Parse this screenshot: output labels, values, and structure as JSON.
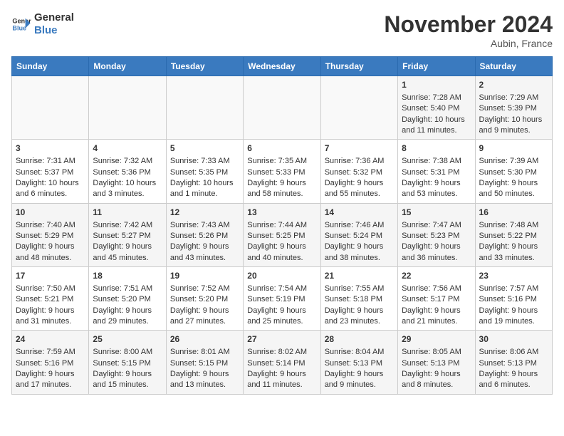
{
  "header": {
    "logo_line1": "General",
    "logo_line2": "Blue",
    "title": "November 2024",
    "location": "Aubin, France"
  },
  "days_of_week": [
    "Sunday",
    "Monday",
    "Tuesday",
    "Wednesday",
    "Thursday",
    "Friday",
    "Saturday"
  ],
  "weeks": [
    [
      {
        "day": "",
        "content": ""
      },
      {
        "day": "",
        "content": ""
      },
      {
        "day": "",
        "content": ""
      },
      {
        "day": "",
        "content": ""
      },
      {
        "day": "",
        "content": ""
      },
      {
        "day": "1",
        "content": "Sunrise: 7:28 AM\nSunset: 5:40 PM\nDaylight: 10 hours and 11 minutes."
      },
      {
        "day": "2",
        "content": "Sunrise: 7:29 AM\nSunset: 5:39 PM\nDaylight: 10 hours and 9 minutes."
      }
    ],
    [
      {
        "day": "3",
        "content": "Sunrise: 7:31 AM\nSunset: 5:37 PM\nDaylight: 10 hours and 6 minutes."
      },
      {
        "day": "4",
        "content": "Sunrise: 7:32 AM\nSunset: 5:36 PM\nDaylight: 10 hours and 3 minutes."
      },
      {
        "day": "5",
        "content": "Sunrise: 7:33 AM\nSunset: 5:35 PM\nDaylight: 10 hours and 1 minute."
      },
      {
        "day": "6",
        "content": "Sunrise: 7:35 AM\nSunset: 5:33 PM\nDaylight: 9 hours and 58 minutes."
      },
      {
        "day": "7",
        "content": "Sunrise: 7:36 AM\nSunset: 5:32 PM\nDaylight: 9 hours and 55 minutes."
      },
      {
        "day": "8",
        "content": "Sunrise: 7:38 AM\nSunset: 5:31 PM\nDaylight: 9 hours and 53 minutes."
      },
      {
        "day": "9",
        "content": "Sunrise: 7:39 AM\nSunset: 5:30 PM\nDaylight: 9 hours and 50 minutes."
      }
    ],
    [
      {
        "day": "10",
        "content": "Sunrise: 7:40 AM\nSunset: 5:29 PM\nDaylight: 9 hours and 48 minutes."
      },
      {
        "day": "11",
        "content": "Sunrise: 7:42 AM\nSunset: 5:27 PM\nDaylight: 9 hours and 45 minutes."
      },
      {
        "day": "12",
        "content": "Sunrise: 7:43 AM\nSunset: 5:26 PM\nDaylight: 9 hours and 43 minutes."
      },
      {
        "day": "13",
        "content": "Sunrise: 7:44 AM\nSunset: 5:25 PM\nDaylight: 9 hours and 40 minutes."
      },
      {
        "day": "14",
        "content": "Sunrise: 7:46 AM\nSunset: 5:24 PM\nDaylight: 9 hours and 38 minutes."
      },
      {
        "day": "15",
        "content": "Sunrise: 7:47 AM\nSunset: 5:23 PM\nDaylight: 9 hours and 36 minutes."
      },
      {
        "day": "16",
        "content": "Sunrise: 7:48 AM\nSunset: 5:22 PM\nDaylight: 9 hours and 33 minutes."
      }
    ],
    [
      {
        "day": "17",
        "content": "Sunrise: 7:50 AM\nSunset: 5:21 PM\nDaylight: 9 hours and 31 minutes."
      },
      {
        "day": "18",
        "content": "Sunrise: 7:51 AM\nSunset: 5:20 PM\nDaylight: 9 hours and 29 minutes."
      },
      {
        "day": "19",
        "content": "Sunrise: 7:52 AM\nSunset: 5:20 PM\nDaylight: 9 hours and 27 minutes."
      },
      {
        "day": "20",
        "content": "Sunrise: 7:54 AM\nSunset: 5:19 PM\nDaylight: 9 hours and 25 minutes."
      },
      {
        "day": "21",
        "content": "Sunrise: 7:55 AM\nSunset: 5:18 PM\nDaylight: 9 hours and 23 minutes."
      },
      {
        "day": "22",
        "content": "Sunrise: 7:56 AM\nSunset: 5:17 PM\nDaylight: 9 hours and 21 minutes."
      },
      {
        "day": "23",
        "content": "Sunrise: 7:57 AM\nSunset: 5:16 PM\nDaylight: 9 hours and 19 minutes."
      }
    ],
    [
      {
        "day": "24",
        "content": "Sunrise: 7:59 AM\nSunset: 5:16 PM\nDaylight: 9 hours and 17 minutes."
      },
      {
        "day": "25",
        "content": "Sunrise: 8:00 AM\nSunset: 5:15 PM\nDaylight: 9 hours and 15 minutes."
      },
      {
        "day": "26",
        "content": "Sunrise: 8:01 AM\nSunset: 5:15 PM\nDaylight: 9 hours and 13 minutes."
      },
      {
        "day": "27",
        "content": "Sunrise: 8:02 AM\nSunset: 5:14 PM\nDaylight: 9 hours and 11 minutes."
      },
      {
        "day": "28",
        "content": "Sunrise: 8:04 AM\nSunset: 5:13 PM\nDaylight: 9 hours and 9 minutes."
      },
      {
        "day": "29",
        "content": "Sunrise: 8:05 AM\nSunset: 5:13 PM\nDaylight: 9 hours and 8 minutes."
      },
      {
        "day": "30",
        "content": "Sunrise: 8:06 AM\nSunset: 5:13 PM\nDaylight: 9 hours and 6 minutes."
      }
    ]
  ]
}
